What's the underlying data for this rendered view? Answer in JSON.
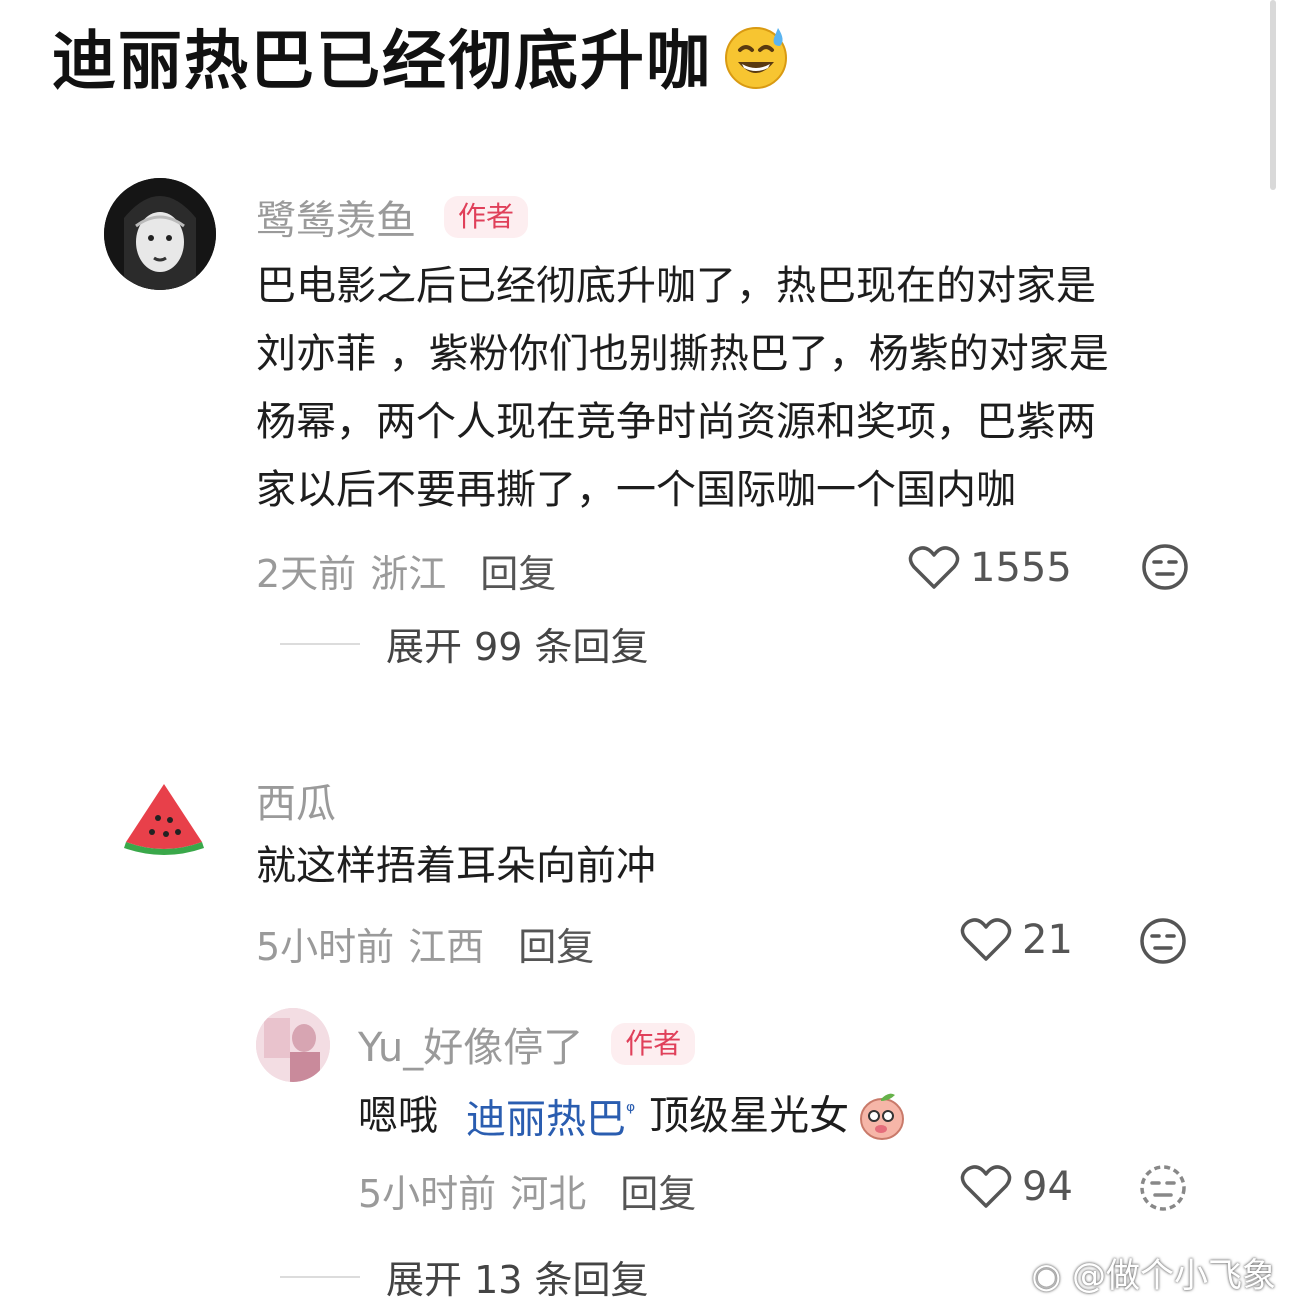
{
  "title": {
    "text": "迪丽热巴已经彻底升咖",
    "emoji": "sweat-smile-emoji"
  },
  "comments": [
    {
      "username": "鹭鸶羡鱼",
      "badge": "作者",
      "text_lines": [
        "巴电影之后已经彻底升咖了，热巴现在的对家是",
        "刘亦菲 ，紫粉你们也别撕热巴了，杨紫的对家是",
        "杨幂，两个人现在竞争时尚资源和奖项，巴紫两",
        "家以后不要再撕了，一个国际咖一个国内咖"
      ],
      "time": "2天前",
      "location": "浙江",
      "reply_label": "回复",
      "likes": "1555",
      "expand_label": "展开 99 条回复"
    },
    {
      "username": "西瓜",
      "text": "就这样捂着耳朵向前冲",
      "time": "5小时前",
      "location": "江西",
      "reply_label": "回复",
      "likes": "21"
    },
    {
      "username": "Yu_好像停了",
      "badge": "作者",
      "prefix": "嗯哦",
      "mention": "迪丽热巴",
      "mention_mark": "ᵠ",
      "suffix": "顶级星光女",
      "time": "5小时前",
      "location": "河北",
      "reply_label": "回复",
      "likes": "94",
      "expand_label": "展开 13 条回复"
    }
  ],
  "watermark": "@做个小飞象",
  "colors": {
    "badge_text": "#e0405a",
    "badge_bg": "#fdeef0",
    "mention": "#2a5db0",
    "meta_gray": "#9a9a9a"
  }
}
